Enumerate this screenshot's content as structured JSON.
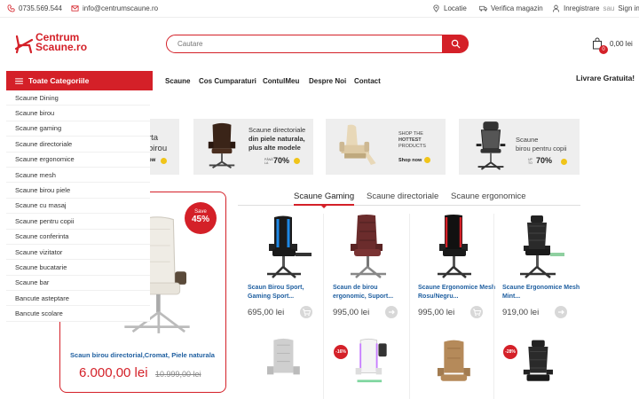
{
  "topbar": {
    "phone": "0735.569.544",
    "email": "info@centrumscaune.ro",
    "location": "Locatie",
    "check_store": "Verifica magazin",
    "register": "Inregistrare",
    "or": "sau",
    "login": "Sign in"
  },
  "logo": {
    "line1": "Centrum",
    "line2": "Scaune.ro"
  },
  "search": {
    "placeholder": "Cautare"
  },
  "cart": {
    "count": "0",
    "total": "0,00 lei"
  },
  "nav": {
    "all_categories": "Toate Categoriile",
    "items": [
      "Scaune",
      "Cos Cumparaturi",
      "ContulMeu",
      "Despre Noi",
      "Contact"
    ],
    "free_delivery": "Livrare Gratuita!"
  },
  "categories": [
    "Scaune Dining",
    "Scaune birou",
    "Scaune gaming",
    "Scaune directoriale",
    "Scaune ergonomice",
    "Scaune mesh",
    "Scaune birou piele",
    "Scaune cu masaj",
    "Scaune pentru copii",
    "Scaune conferinta",
    "Scaune vizitator",
    "Scaune bucatarie",
    "Scaune bar",
    "Bancute asteptare",
    "Bancute scolare"
  ],
  "banners": [
    {
      "text": "rta birou",
      "cta": "ow"
    },
    {
      "line1": "Scaune directoriale",
      "line2": "din piele naturala,",
      "line3": "plus alte modele",
      "upto": "PÂNĂ LA",
      "percent": "70%"
    },
    {
      "line1": "SHOP THE",
      "line2": "HOTTEST",
      "line3": "PRODUCTS",
      "cta": "Shop now"
    },
    {
      "line1": "Scaune",
      "line2": "birou pentru copii",
      "upto": "UP TO",
      "percent": "70%"
    }
  ],
  "featured": {
    "save_label": "Save",
    "save_percent": "45%",
    "name": "Scaun birou directorial,Cromat, Piele naturala",
    "price": "6.000,00 lei",
    "old_price": "10.999,00 lei"
  },
  "tabs": [
    "Scaune Gaming",
    "Scaune directoriale",
    "Scaune ergonomice"
  ],
  "products": [
    {
      "name": "Scaun Birou Sport, Gaming Sport...",
      "price": "695,00 lei"
    },
    {
      "name": "Scaun de birou ergonomic, Suport...",
      "price": "995,00 lei"
    },
    {
      "name": "Scaune Ergonomice Mesh Rosu/Negru...",
      "price": "995,00 lei"
    },
    {
      "name": "Scaune Ergonomice Mesh Mint...",
      "price": "919,00 lei"
    }
  ],
  "product_row2": [
    {
      "discount": ""
    },
    {
      "discount": "-16%"
    },
    {
      "discount": ""
    },
    {
      "discount": "-28%"
    }
  ],
  "colors": {
    "accent": "#d42028",
    "link": "#1f5fa0"
  }
}
